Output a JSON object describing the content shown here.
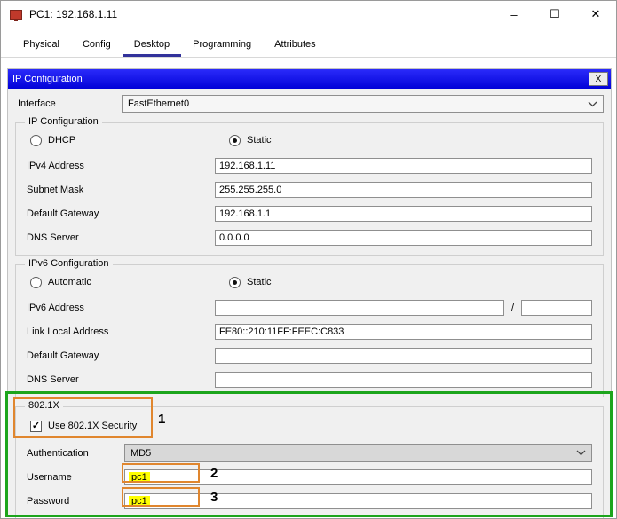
{
  "window": {
    "title": "PC1: 192.168.1.11",
    "controls": {
      "minimize": "–",
      "maximize": "☐",
      "close": "✕"
    }
  },
  "tabs": [
    {
      "label": "Physical"
    },
    {
      "label": "Config"
    },
    {
      "label": "Desktop"
    },
    {
      "label": "Programming"
    },
    {
      "label": "Attributes"
    }
  ],
  "panel": {
    "title": "IP Configuration",
    "close_label": "X"
  },
  "interface": {
    "label": "Interface",
    "value": "FastEthernet0"
  },
  "ipv4": {
    "group_title": "IP Configuration",
    "dhcp_label": "DHCP",
    "static_label": "Static",
    "rows": [
      {
        "label": "IPv4 Address",
        "value": "192.168.1.11"
      },
      {
        "label": "Subnet Mask",
        "value": "255.255.255.0"
      },
      {
        "label": "Default Gateway",
        "value": "192.168.1.1"
      },
      {
        "label": "DNS Server",
        "value": "0.0.0.0"
      }
    ]
  },
  "ipv6": {
    "group_title": "IPv6 Configuration",
    "automatic_label": "Automatic",
    "static_label": "Static",
    "address_label": "IPv6 Address",
    "address_value": "",
    "prefix_separator": "/",
    "prefix_value": "",
    "rows": [
      {
        "label": "Link Local Address",
        "value": "FE80::210:11FF:FEEC:C833"
      },
      {
        "label": "Default Gateway",
        "value": ""
      },
      {
        "label": "DNS Server",
        "value": ""
      }
    ]
  },
  "dot1x": {
    "group_title": "802.1X",
    "checkbox_label": "Use 802.1X Security",
    "authentication_label": "Authentication",
    "authentication_value": "MD5",
    "username_label": "Username",
    "username_value": "pc1",
    "password_label": "Password",
    "password_value": "pc1"
  },
  "annotations": {
    "one": "1",
    "two": "2",
    "three": "3"
  },
  "icons": {
    "checkmark": "✓"
  },
  "colors": {
    "panel_header_blue": "#0b0bf0",
    "annotation_green": "#1ca51c",
    "annotation_orange": "#e0862e",
    "highlight_yellow": "#ffff00",
    "tab_underline_blue": "#32329b"
  }
}
